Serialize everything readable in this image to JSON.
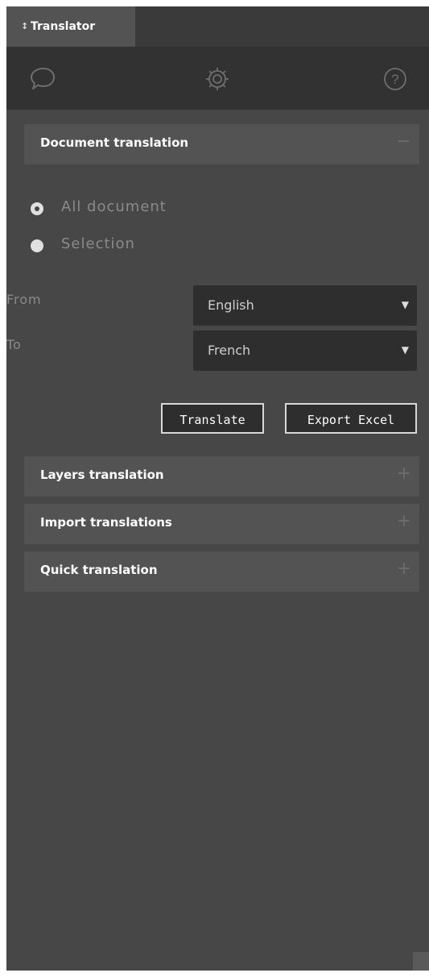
{
  "panel": {
    "tab_arrow": "↕",
    "tab_title": "Translator"
  },
  "toolbar": {
    "icons": [
      "chat-bubble-icon",
      "gear-icon",
      "help-icon"
    ]
  },
  "document_section": {
    "title": "Document translation",
    "toggle": "−",
    "radio_all": "All document",
    "radio_selection": "Selection",
    "selected_radio": "All document",
    "from_label": "From",
    "from_value": "English",
    "to_label": "To",
    "to_value": "French",
    "caret": "▼",
    "translate_button": "Translate",
    "export_button": "Export Excel"
  },
  "sections": [
    {
      "title": "Layers translation",
      "toggle": "+"
    },
    {
      "title": "Import translations",
      "toggle": "+"
    },
    {
      "title": "Quick translation",
      "toggle": "+"
    }
  ],
  "colors": {
    "panel_bg": "#474747",
    "header_bg": "#323232",
    "section_bg": "#535353",
    "select_bg": "#2e2e2e"
  }
}
